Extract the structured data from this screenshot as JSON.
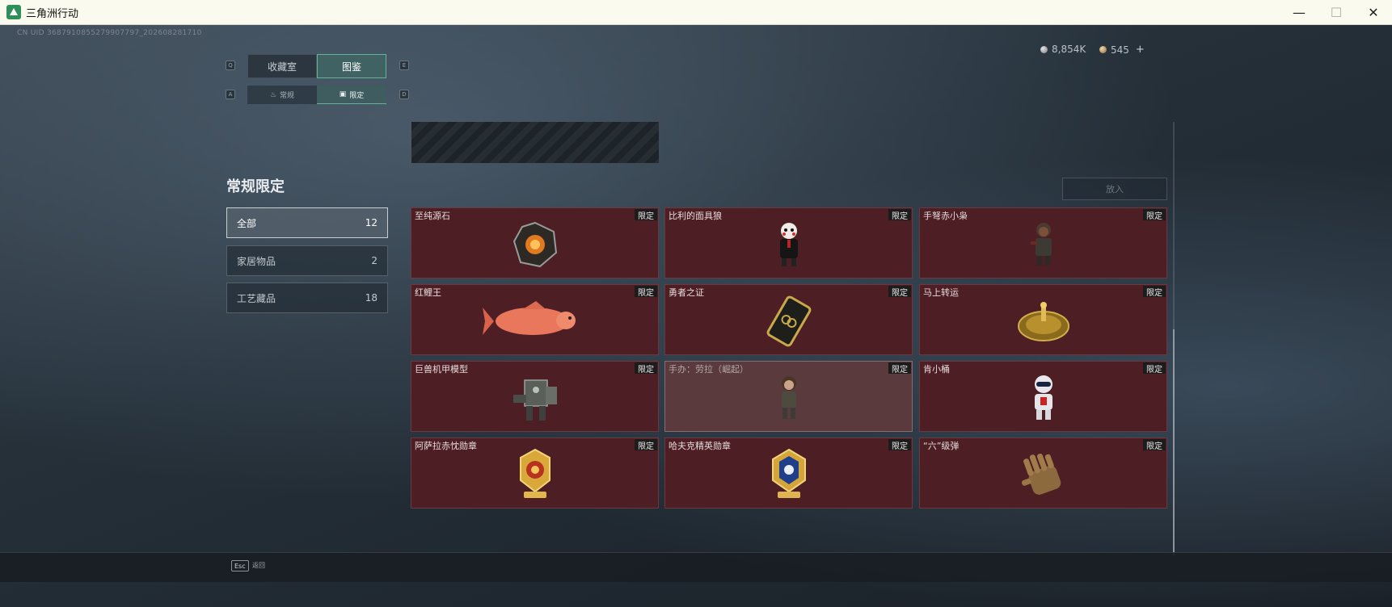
{
  "window": {
    "title": "三角洲行动",
    "minimize": "—",
    "maximize": "☐",
    "close": "✕"
  },
  "uid_text": "CN UID 3687910855279907797_202608281710",
  "currency": {
    "silver": "8,854K",
    "gold": "545",
    "plus": "+"
  },
  "main_tabs": {
    "key_left": "Q",
    "key_right": "E",
    "items": [
      {
        "label": "收藏室"
      },
      {
        "label": "图鉴"
      }
    ],
    "active": 1
  },
  "sub_tabs": {
    "key_left": "A",
    "key_right": "D",
    "items": [
      {
        "label": "常规"
      },
      {
        "label": "限定"
      }
    ],
    "active": 1
  },
  "search_placeholder": "放入",
  "panel": {
    "title": "常规限定",
    "categories": [
      {
        "label": "全部",
        "count": "12"
      },
      {
        "label": "家居物品",
        "count": "2"
      },
      {
        "label": "工艺藏品",
        "count": "18"
      }
    ]
  },
  "badge_label": "限定",
  "items": [
    {
      "name": "至纯源石",
      "icon": "gem-icon"
    },
    {
      "name": "比利的面具狼",
      "icon": "puppet-icon"
    },
    {
      "name": "手弩赤小枭",
      "icon": "figure-icon"
    },
    {
      "name": "红鲤王",
      "icon": "fish-icon"
    },
    {
      "name": "勇者之证",
      "icon": "card-icon"
    },
    {
      "name": "马上转运",
      "icon": "compass-icon"
    },
    {
      "name": "巨兽机甲模型",
      "icon": "mech-icon"
    },
    {
      "name": "手办：劳拉（崛起）",
      "icon": "figurine-icon"
    },
    {
      "name": "肯小桶",
      "icon": "robot-icon"
    },
    {
      "name": "阿萨拉赤忱勋章",
      "icon": "medal-red-icon"
    },
    {
      "name": "哈夫克精英勋章",
      "icon": "medal-blue-icon"
    },
    {
      "name": "“六”级弹",
      "icon": "glove-icon"
    }
  ],
  "bottom": {
    "esc_key": "Esc",
    "esc_label": "返回"
  },
  "colors": {
    "card_bg": "#4d1f24",
    "accent_green": "#62b59a",
    "titlebar": "#fbfaef"
  }
}
